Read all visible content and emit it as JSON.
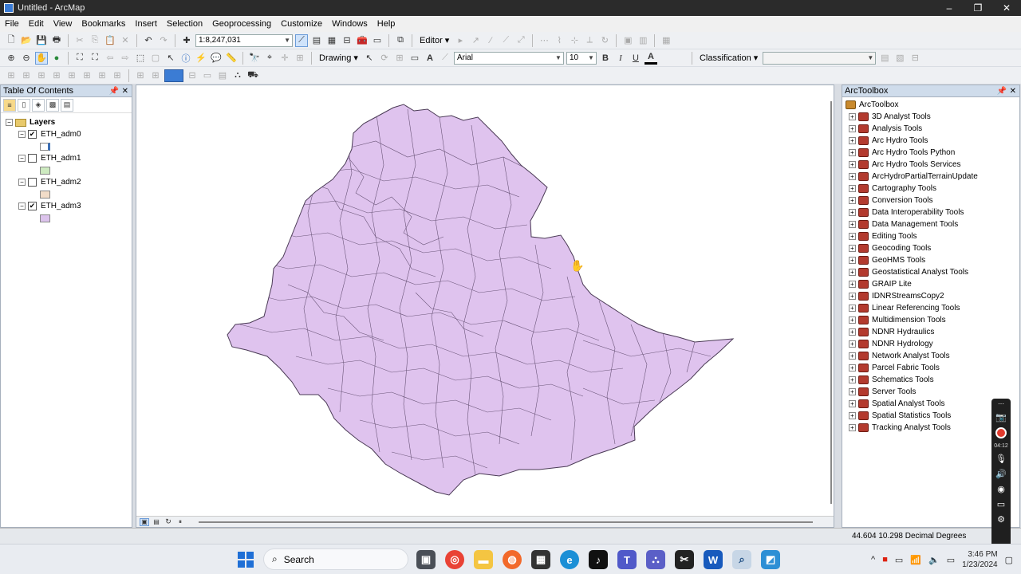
{
  "window": {
    "title": "Untitled - ArcMap",
    "controls": [
      "–",
      "❐",
      "✕"
    ]
  },
  "menu": [
    "File",
    "Edit",
    "View",
    "Bookmarks",
    "Insert",
    "Selection",
    "Geoprocessing",
    "Customize",
    "Windows",
    "Help"
  ],
  "toolbar": {
    "scale": "1:8,247,031",
    "editor_label": "Editor ▾",
    "drawing_label": "Drawing ▾",
    "font_name": "Arial",
    "font_size": "10",
    "bold": "B",
    "italic": "I",
    "underline": "U",
    "font_color_glyph": "A",
    "text_glyph": "A",
    "classification_label": "Classification ▾"
  },
  "toc": {
    "title": "Table Of Contents",
    "root": "Layers",
    "layers": [
      {
        "name": "ETH_adm0",
        "checked": true,
        "swatch": "#ffffff"
      },
      {
        "name": "ETH_adm1",
        "checked": false,
        "swatch": "#cdeac0"
      },
      {
        "name": "ETH_adm2",
        "checked": false,
        "swatch": "#f1dcc8"
      },
      {
        "name": "ETH_adm3",
        "checked": true,
        "swatch": "#dcc3ec"
      }
    ]
  },
  "map": {
    "fill_color": "#dfc3ee",
    "stroke_color": "#4a3a55"
  },
  "toolbox": {
    "title": "ArcToolbox",
    "root": "ArcToolbox",
    "tools": [
      "3D Analyst Tools",
      "Analysis Tools",
      "Arc Hydro Tools",
      "Arc Hydro Tools Python",
      "Arc Hydro Tools Services",
      "ArcHydroPartialTerrainUpdate",
      "Cartography Tools",
      "Conversion Tools",
      "Data Interoperability Tools",
      "Data Management Tools",
      "Editing Tools",
      "Geocoding Tools",
      "GeoHMS Tools",
      "Geostatistical Analyst Tools",
      "GRAIP Lite",
      "IDNRStreamsCopy2",
      "Linear Referencing Tools",
      "Multidimension Tools",
      "NDNR Hydraulics",
      "NDNR Hydrology",
      "Network Analyst Tools",
      "Parcel Fabric Tools",
      "Schematics Tools",
      "Server Tools",
      "Spatial Analyst Tools",
      "Spatial Statistics Tools",
      "Tracking Analyst Tools"
    ]
  },
  "status": {
    "coords": "44.604  10.298 Decimal Degrees"
  },
  "taskbar": {
    "search": "Search",
    "time": "3:46 PM",
    "date": "1/23/2024",
    "recorder_time": "04:12"
  }
}
